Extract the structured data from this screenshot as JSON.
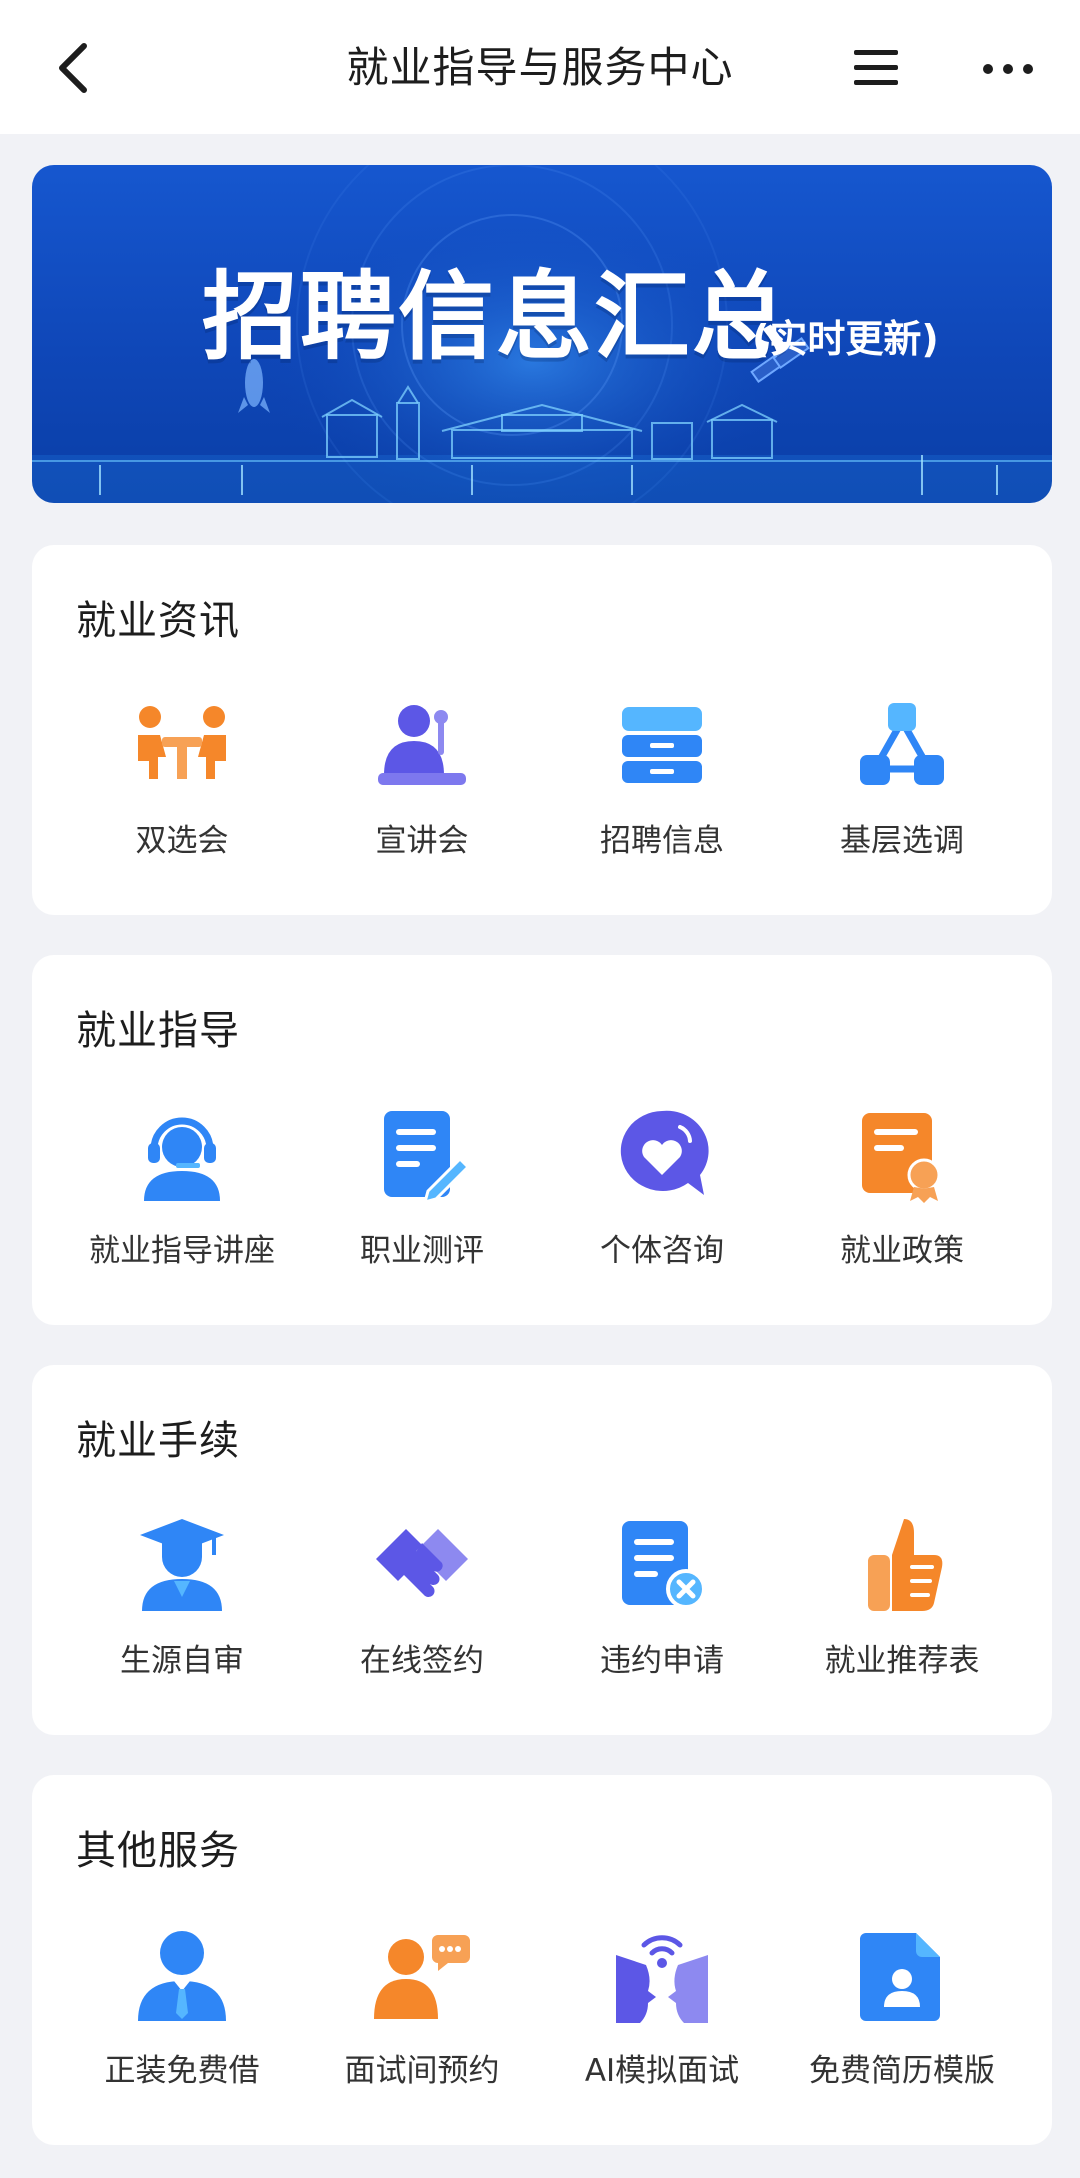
{
  "header": {
    "title": "就业指导与服务中心",
    "back_icon": "chevron-left-icon",
    "menu_icon": "hamburger-menu-icon",
    "more_icon": "more-dots-icon"
  },
  "banner": {
    "title": "招聘信息汇总",
    "subtitle": "(实时更新)"
  },
  "colors": {
    "orange": "#f5872a",
    "blue": "#2f86f6",
    "purple": "#5c57e6",
    "banner": "#1250c4"
  },
  "sections": [
    {
      "title": "就业资讯",
      "items": [
        {
          "label": "双选会",
          "icon": "two-people-table-icon"
        },
        {
          "label": "宣讲会",
          "icon": "speaker-podium-icon"
        },
        {
          "label": "招聘信息",
          "icon": "drawer-cabinet-icon"
        },
        {
          "label": "基层选调",
          "icon": "hierarchy-nodes-icon"
        }
      ]
    },
    {
      "title": "就业指导",
      "items": [
        {
          "label": "就业指导讲座",
          "icon": "headset-person-icon"
        },
        {
          "label": "职业测评",
          "icon": "document-pencil-icon"
        },
        {
          "label": "个体咨询",
          "icon": "heart-chat-icon"
        },
        {
          "label": "就业政策",
          "icon": "certificate-icon"
        }
      ]
    },
    {
      "title": "就业手续",
      "items": [
        {
          "label": "生源自审",
          "icon": "graduate-icon"
        },
        {
          "label": "在线签约",
          "icon": "handshake-icon"
        },
        {
          "label": "违约申请",
          "icon": "document-cancel-icon"
        },
        {
          "label": "就业推荐表",
          "icon": "thumbs-up-icon"
        }
      ]
    },
    {
      "title": "其他服务",
      "items": [
        {
          "label": "正装免费借",
          "icon": "suit-person-icon"
        },
        {
          "label": "面试间预约",
          "icon": "people-chat-icon"
        },
        {
          "label": "AI模拟面试",
          "icon": "ai-faces-signal-icon"
        },
        {
          "label": "免费简历模版",
          "icon": "resume-file-icon"
        }
      ]
    }
  ]
}
